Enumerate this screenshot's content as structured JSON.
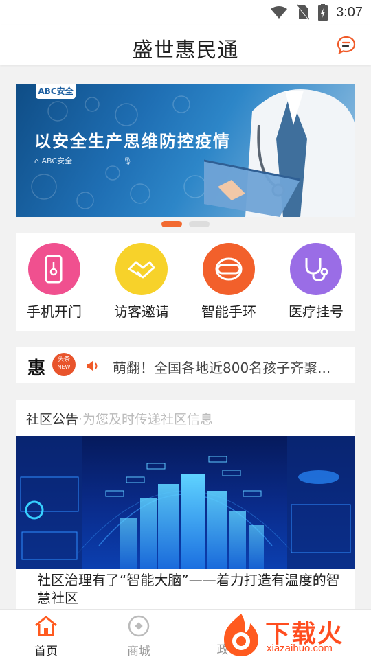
{
  "status_bar": {
    "time": "3:07"
  },
  "header": {
    "title": "盛世惠民通"
  },
  "banner": {
    "logo": "ABC安全",
    "headline": "以安全生产思维防控疫情",
    "sub_brand": "ABC安全"
  },
  "quick_actions": [
    {
      "label": "手机开门",
      "color": "#f0508f",
      "icon": "phone-key-icon"
    },
    {
      "label": "访客邀请",
      "color": "#f7d22a",
      "icon": "handshake-icon"
    },
    {
      "label": "智能手环",
      "color": "#f2602b",
      "icon": "wristband-icon"
    },
    {
      "label": "医疗挂号",
      "color": "#9a6de6",
      "icon": "stethoscope-icon"
    }
  ],
  "news": {
    "brand": "惠",
    "badge_line1": "头条",
    "badge_line2": "NEW",
    "headline": "萌翻！全国各地近800名孩子齐聚..."
  },
  "notice": {
    "title": "社区公告",
    "subtitle": "·为您及时传递社区信息",
    "article_title": "社区治理有了“智能大脑”——着力打造有温度的智慧社区"
  },
  "tabbar": {
    "items": [
      {
        "label": "首页",
        "active": true
      },
      {
        "label": "商城",
        "active": false
      },
      {
        "label": "政",
        "active": false
      }
    ]
  },
  "watermark": {
    "cn": "下载火",
    "en": "xiazaihuo.com"
  },
  "colors": {
    "accent": "#f26a31",
    "active_tab": "#ff5a1f"
  }
}
